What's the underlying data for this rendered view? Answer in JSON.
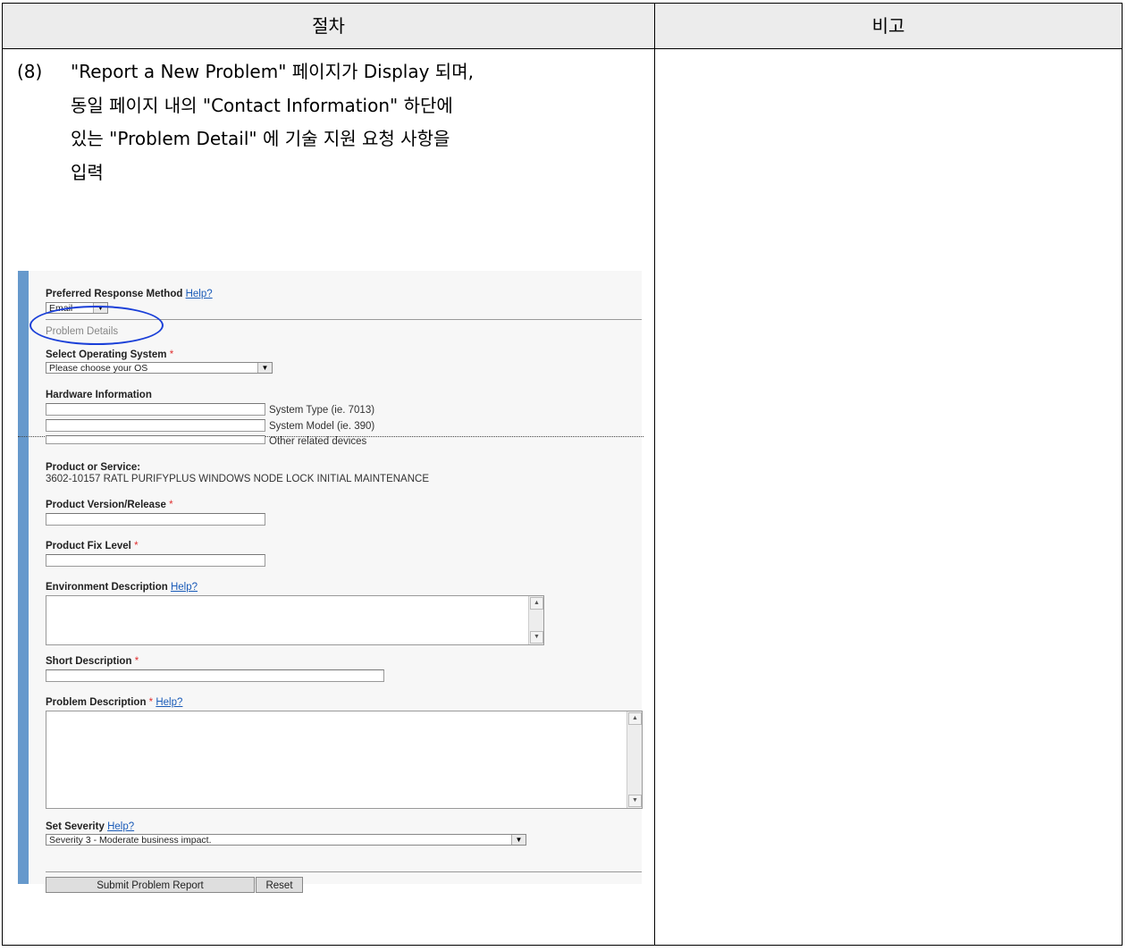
{
  "table": {
    "col1_header": "절차",
    "col2_header": "비고"
  },
  "step": {
    "number": "(8)",
    "lines": [
      "\"Report a New Problem\" 페이지가 Display 되며,",
      "동일 페이지 내의 \"Contact Information\" 하단에",
      "있는 \"Problem Detail\" 에 기술 지원 요청 사항을",
      "입력"
    ]
  },
  "form": {
    "preferred_response_label": "Preferred Response Method",
    "help": "Help?",
    "response_value": "Email",
    "section_title": "Problem Details",
    "os_label": "Select Operating System",
    "required_mark": "*",
    "os_value": "Please choose your OS",
    "hardware_label": "Hardware Information",
    "system_type": "System Type (ie. 7013)",
    "system_model": "System Model (ie. 390)",
    "other_devices": "Other related devices",
    "product_label": "Product or Service:",
    "product_value": "3602-10157 RATL PURIFYPLUS WINDOWS NODE LOCK INITIAL MAINTENANCE",
    "version_label": "Product Version/Release",
    "fix_label": "Product Fix Level",
    "env_label": "Environment Description",
    "short_label": "Short Description",
    "problem_label": "Problem Description",
    "severity_label": "Set Severity",
    "severity_value": "Severity 3 - Moderate business impact.",
    "submit_label": "Submit Problem Report",
    "reset_label": "Reset"
  },
  "colors": {
    "left_bar": "#6699cc",
    "highlight_ellipse": "#1a3fd8",
    "link": "#1a5bb8",
    "required": "#e03030"
  }
}
